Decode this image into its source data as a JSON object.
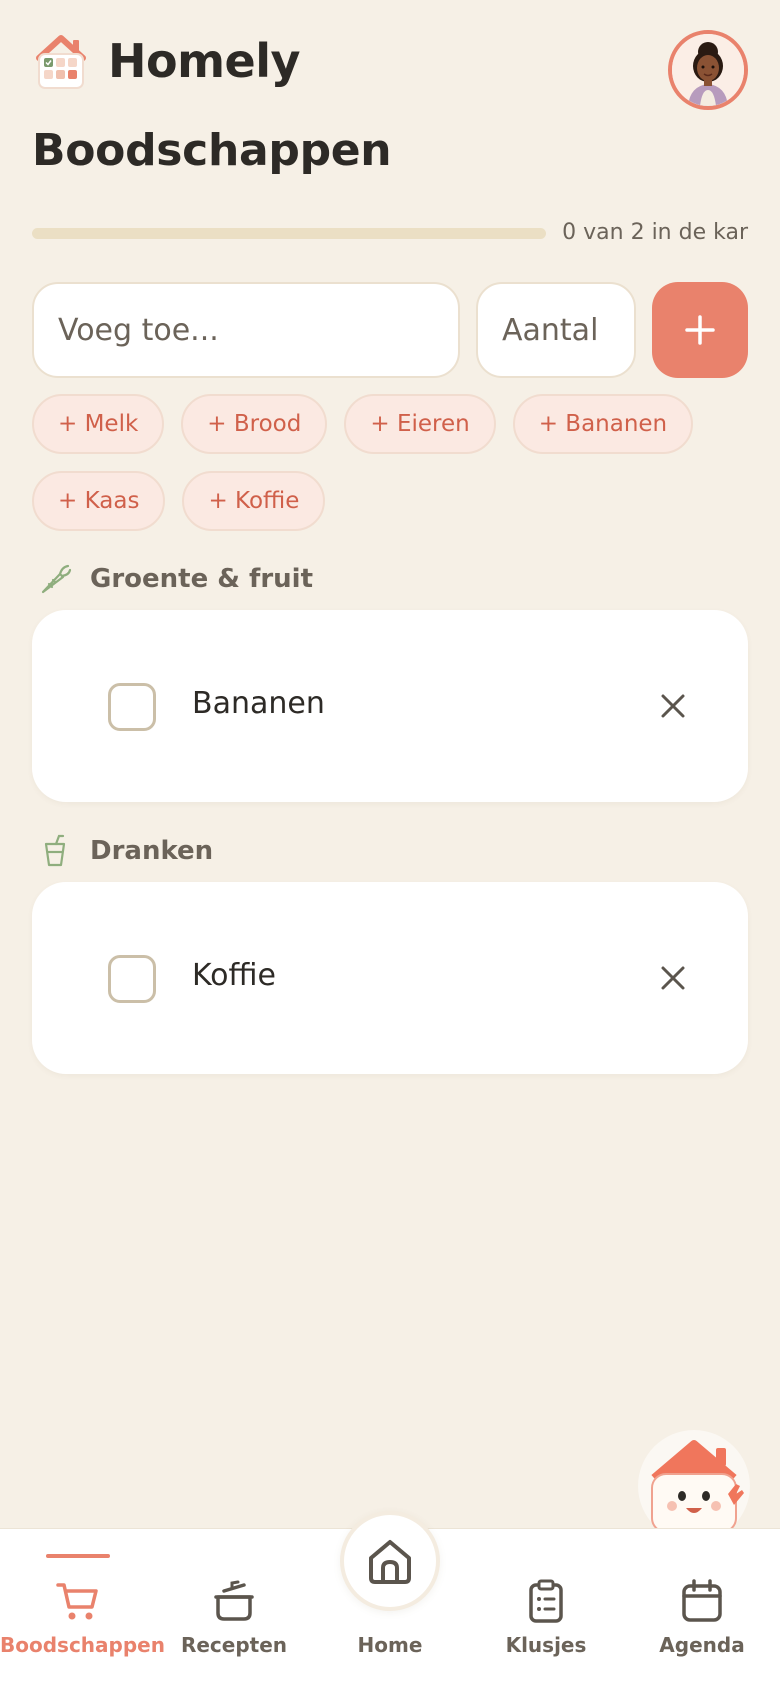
{
  "app": {
    "name": "Homely"
  },
  "page": {
    "title": "Boodschappen"
  },
  "progress": {
    "checked": 0,
    "total": 2,
    "fraction": 0.0,
    "text": "0 van 2 in de kar"
  },
  "add_form": {
    "item_placeholder": "Voeg toe...",
    "qty_placeholder": "Aantal",
    "add_icon": "plus-icon"
  },
  "quick_add": [
    "+ Melk",
    "+ Brood",
    "+ Eieren",
    "+ Bananen",
    "+ Kaas",
    "+ Koffie"
  ],
  "categories": [
    {
      "label": "Groente & fruit",
      "icon": "carrot-icon",
      "items": [
        {
          "name": "Bananen",
          "checked": false
        }
      ]
    },
    {
      "label": "Dranken",
      "icon": "cup-icon",
      "items": [
        {
          "name": "Koffie",
          "checked": false
        }
      ]
    }
  ],
  "nav": {
    "items": [
      {
        "label": "Boodschappen",
        "icon": "cart-icon",
        "active": true
      },
      {
        "label": "Recepten",
        "icon": "pot-icon",
        "active": false
      },
      {
        "label": "Home",
        "icon": "home-icon",
        "active": false
      },
      {
        "label": "Klusjes",
        "icon": "clipboard-icon",
        "active": false
      },
      {
        "label": "Agenda",
        "icon": "calendar-icon",
        "active": false
      }
    ]
  },
  "colors": {
    "background": "#f6f0e6",
    "accent": "#e9826c",
    "chip_text": "#d0604a",
    "progress_track": "#ebdfc4",
    "muted_text": "#6b6359",
    "category_icon": "#8fae7e"
  }
}
